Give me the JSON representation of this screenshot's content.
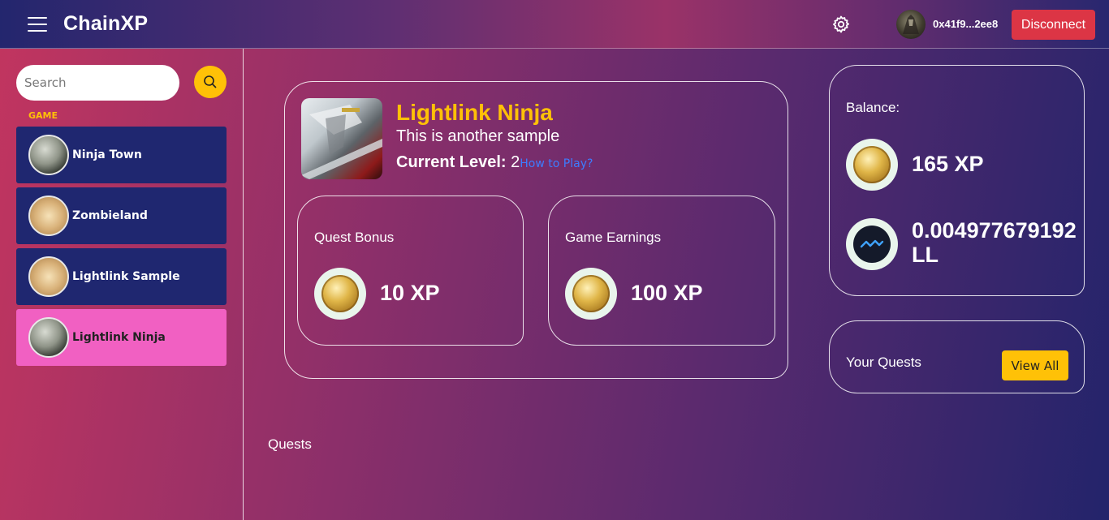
{
  "header": {
    "brand": "ChainXP",
    "wallet_address": "0x41f9...2ee8",
    "disconnect_label": "Disconnect",
    "menu_icon": "hamburger-icon",
    "settings_icon": "gear-icon"
  },
  "sidebar": {
    "search_placeholder": "Search",
    "section_label": "GAME",
    "items": [
      {
        "label": "Ninja Town",
        "active": false
      },
      {
        "label": "Zombieland",
        "active": false
      },
      {
        "label": "Lightlink Sample",
        "active": false
      },
      {
        "label": "Lightlink Ninja",
        "active": true
      }
    ]
  },
  "game": {
    "title": "Lightlink Ninja",
    "description": "This is another sample",
    "level_label": "Current Level:",
    "level_value": " 2",
    "how_to_play": "How to Play?"
  },
  "stats": {
    "quest_bonus_label": "Quest Bonus",
    "quest_bonus_value": "10 XP",
    "game_earnings_label": "Game Earnings",
    "game_earnings_value": "100 XP"
  },
  "balance": {
    "label": "Balance:",
    "xp": "165 XP",
    "ll": "0.004977679192 LL"
  },
  "quests": {
    "your_quests_label": "Your Quests",
    "view_all_label": "View All",
    "heading": "Quests"
  },
  "colors": {
    "accent_yellow": "#ffc107",
    "disconnect_red": "#dc3545",
    "sidebar_item": "#1f2770",
    "sidebar_active": "#f160c2",
    "link_blue": "#3d7cff"
  }
}
